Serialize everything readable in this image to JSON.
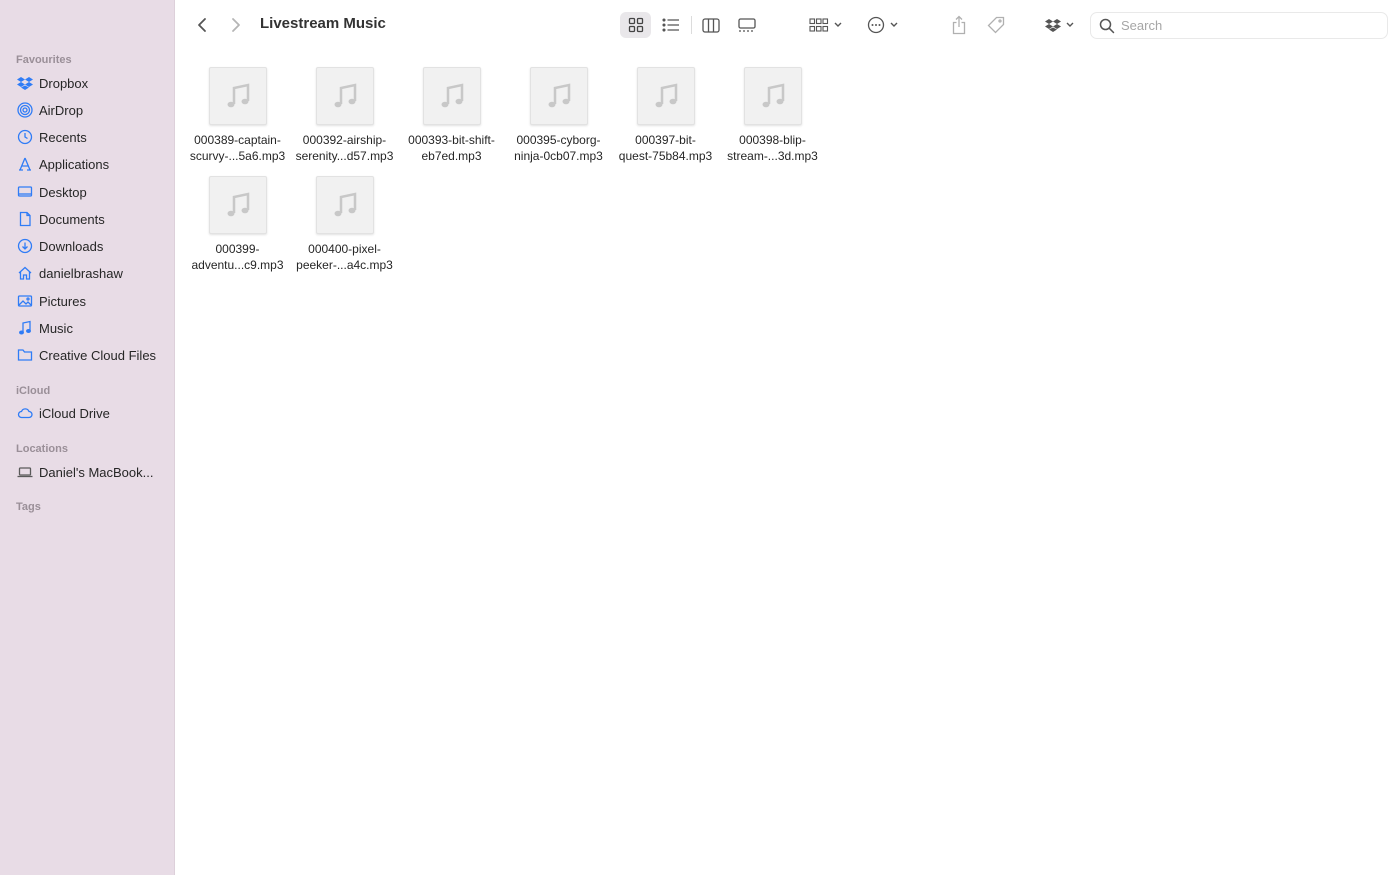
{
  "window": {
    "title": "Livestream Music"
  },
  "sidebar": {
    "sections": {
      "favourites": "Favourites",
      "icloud": "iCloud",
      "locations": "Locations",
      "tags": "Tags"
    },
    "favourites": [
      {
        "label": "Dropbox",
        "icon": "dropbox-icon"
      },
      {
        "label": "AirDrop",
        "icon": "airdrop-icon"
      },
      {
        "label": "Recents",
        "icon": "clock-icon"
      },
      {
        "label": "Applications",
        "icon": "applications-icon"
      },
      {
        "label": "Desktop",
        "icon": "desktop-icon"
      },
      {
        "label": "Documents",
        "icon": "document-icon"
      },
      {
        "label": "Downloads",
        "icon": "download-icon"
      },
      {
        "label": "danielbrashaw",
        "icon": "home-icon"
      },
      {
        "label": "Pictures",
        "icon": "pictures-icon"
      },
      {
        "label": "Music",
        "icon": "music-icon"
      },
      {
        "label": "Creative Cloud Files",
        "icon": "folder-icon"
      }
    ],
    "icloud": [
      {
        "label": "iCloud Drive",
        "icon": "cloud-icon"
      }
    ],
    "locations": [
      {
        "label": "Daniel's MacBook...",
        "icon": "laptop-icon"
      }
    ]
  },
  "toolbar": {
    "search_placeholder": "Search",
    "active_view": "icon"
  },
  "files": [
    {
      "line1": "000389-captain-",
      "line2": "scurvy-...5a6.mp3"
    },
    {
      "line1": "000392-airship-",
      "line2": "serenity...d57.mp3"
    },
    {
      "line1": "000393-bit-shift-",
      "line2": "eb7ed.mp3"
    },
    {
      "line1": "000395-cyborg-",
      "line2": "ninja-0cb07.mp3"
    },
    {
      "line1": "000397-bit-",
      "line2": "quest-75b84.mp3"
    },
    {
      "line1": "000398-blip-",
      "line2": "stream-...3d.mp3"
    },
    {
      "line1": "000399-",
      "line2": "adventu...c9.mp3"
    },
    {
      "line1": "000400-pixel-",
      "line2": "peeker-...a4c.mp3"
    }
  ],
  "colors": {
    "sidebar_bg": "#e8dce6",
    "accent_blue": "#2f7cf6"
  }
}
